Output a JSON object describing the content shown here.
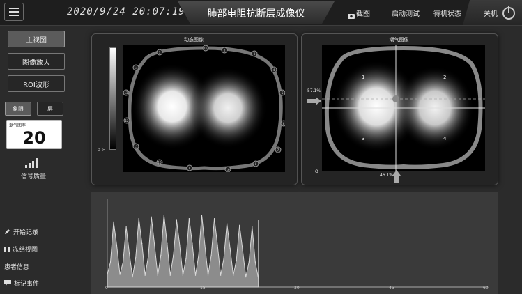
{
  "header": {
    "datetime": "2020/9/24 20:07:19",
    "title": "肺部电阻抗断层成像仪",
    "screenshot_label": "截图",
    "start_test_label": "启动测试",
    "standby_label": "待机状态",
    "shutdown_label": "关机"
  },
  "left_nav": {
    "items": [
      "主视图",
      "图像放大",
      "ROI波形"
    ],
    "active_index": 0,
    "mode_buttons": [
      "象限",
      "层"
    ],
    "tidal": {
      "label": "潮气图率",
      "value": "20"
    },
    "signal_label": "信号质量"
  },
  "side_actions": {
    "start_record": "开始记录",
    "freeze_view": "冻结视图",
    "patient_info": "患者信息",
    "mark_event": "标记事件"
  },
  "dynamic_panel": {
    "title": "动态图像",
    "scale_label": "0->",
    "electrodes": [
      "1",
      "2",
      "3",
      "4",
      "5",
      "6",
      "7",
      "8",
      "9",
      "10",
      "11",
      "12",
      "13",
      "14",
      "15",
      "16"
    ]
  },
  "tidal_panel": {
    "title": "潮气图像",
    "quadrants": [
      "1",
      "2",
      "3",
      "4"
    ],
    "h_percent": "57.1%",
    "v_percent": "46.1%",
    "origin_label": "O"
  },
  "chart_data": {
    "type": "area",
    "title": "",
    "xlabel": "",
    "ylabel": "",
    "xlim": [
      0,
      60
    ],
    "ylim": [
      0,
      1
    ],
    "x_ticks": [
      "0",
      "15",
      "30",
      "45",
      "60"
    ],
    "series": [
      {
        "x": [
          0,
          0.5,
          1,
          1.5,
          2,
          2.5,
          3,
          3.5,
          4,
          4.5,
          5,
          5.5,
          6,
          6.5,
          7,
          7.5,
          8,
          8.5,
          9,
          9.5,
          10,
          10.5,
          11,
          11.5,
          12,
          12.5,
          13,
          13.5,
          14,
          14.5,
          15,
          15.5,
          16,
          16.5,
          17,
          17.5,
          18,
          18.5,
          19,
          19.5,
          20,
          20.5,
          21,
          21.5,
          22,
          22.5,
          23,
          23.5,
          24
        ],
        "values": [
          0.15,
          0.3,
          0.78,
          0.5,
          0.15,
          0.3,
          0.72,
          0.4,
          0.12,
          0.35,
          0.82,
          0.52,
          0.14,
          0.36,
          0.84,
          0.5,
          0.14,
          0.38,
          0.86,
          0.52,
          0.14,
          0.38,
          0.8,
          0.5,
          0.14,
          0.34,
          0.82,
          0.52,
          0.14,
          0.38,
          0.86,
          0.5,
          0.14,
          0.38,
          0.82,
          0.5,
          0.14,
          0.34,
          0.76,
          0.46,
          0.14,
          0.32,
          0.74,
          0.44,
          0.12,
          0.3,
          0.72,
          0.3,
          0.1
        ]
      }
    ]
  },
  "colors": {
    "accent": "#ffffff",
    "background": "#2b2b2b"
  }
}
